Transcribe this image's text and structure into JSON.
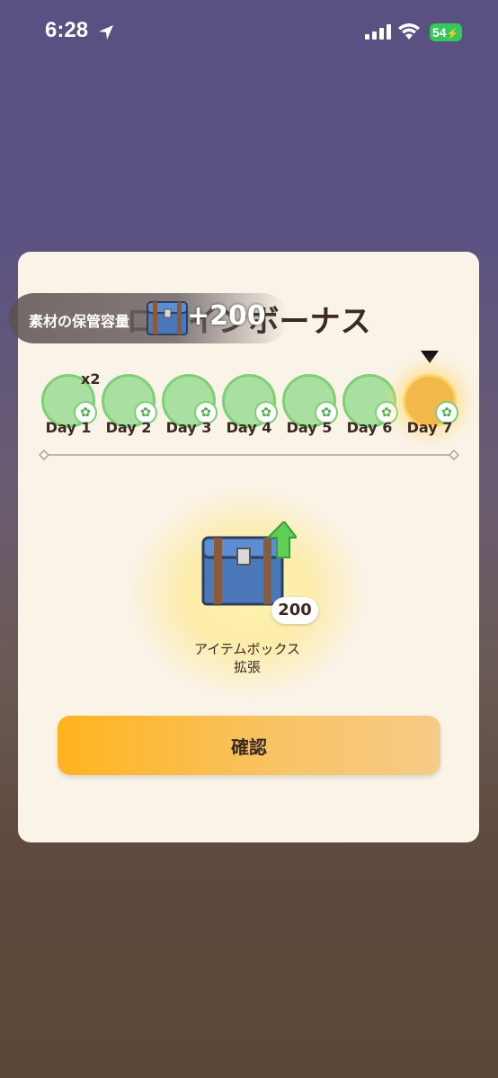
{
  "status_bar": {
    "time": "6:28",
    "battery": "54"
  },
  "dialog": {
    "title": "ログインボーナス",
    "toast": {
      "label": "素材の保管容量",
      "amount": "+200"
    },
    "days": [
      {
        "label": "Day 1",
        "state": "claimed",
        "multiplier": "x2"
      },
      {
        "label": "Day 2",
        "state": "claimed"
      },
      {
        "label": "Day 3",
        "state": "claimed"
      },
      {
        "label": "Day 4",
        "state": "claimed"
      },
      {
        "label": "Day 5",
        "state": "claimed"
      },
      {
        "label": "Day 6",
        "state": "claimed"
      },
      {
        "label": "Day 7",
        "state": "current"
      }
    ],
    "reward": {
      "count": "200",
      "name_line1": "アイテムボックス",
      "name_line2": "拡張"
    },
    "confirm_label": "確認"
  },
  "colors": {
    "accent": "#ffb31f",
    "day_green": "#a9e0a2",
    "card": "#faf3e8"
  }
}
